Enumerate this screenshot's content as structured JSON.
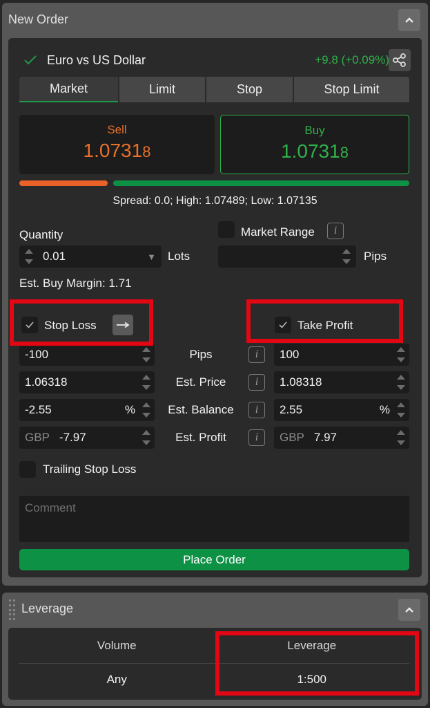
{
  "order_panel": {
    "title": "New Order",
    "collapse_icon": "chevron-up-icon",
    "instrument": {
      "status_icon": "check-icon",
      "name": "Euro vs US Dollar",
      "change": "+9.8 (+0.09%)",
      "share_icon": "share-icon"
    },
    "tabs": [
      {
        "label": "Market",
        "active": true
      },
      {
        "label": "Limit",
        "active": false
      },
      {
        "label": "Stop",
        "active": false
      },
      {
        "label": "Stop Limit",
        "active": false
      }
    ],
    "sell": {
      "label": "Sell",
      "price_main": "1.0731",
      "price_pip": "8",
      "color": "#e8702a"
    },
    "buy": {
      "label": "Buy",
      "price_main": "1.0731",
      "price_pip": "8",
      "color": "#2fb14a"
    },
    "sentiment": {
      "sell_fraction": 0.23,
      "buy_fraction": 0.77
    },
    "spread_text": "Spread: 0.0; High: 1.07489; Low: 1.07135",
    "quantity": {
      "label": "Quantity",
      "value": "0.01",
      "unit": "Lots"
    },
    "market_range": {
      "label": "Market Range",
      "checked": false,
      "value": "",
      "unit": "Pips"
    },
    "margin_text": "Est. Buy Margin: 1.71",
    "stop_loss": {
      "label": "Stop Loss",
      "checked": true,
      "arrow_icon": "arrow-right-icon",
      "pips": "-100",
      "price": "1.06318",
      "balance": "-2.55",
      "balance_unit": "%",
      "profit_currency": "GBP",
      "profit": "-7.97"
    },
    "take_profit": {
      "label": "Take Profit",
      "checked": true,
      "pips": "100",
      "price": "1.08318",
      "balance": "2.55",
      "balance_unit": "%",
      "profit_currency": "GBP",
      "profit": "7.97"
    },
    "row_labels": [
      "Pips",
      "Est. Price",
      "Est. Balance",
      "Est. Profit"
    ],
    "trailing_stop": {
      "label": "Trailing Stop Loss",
      "checked": false
    },
    "comment_placeholder": "Comment",
    "place_order_label": "Place Order",
    "accent_color": "#0d9145"
  },
  "leverage_panel": {
    "title": "Leverage",
    "columns": [
      "Volume",
      "Leverage"
    ],
    "rows": [
      [
        "Any",
        "1:500"
      ]
    ]
  },
  "annotations": {
    "highlight_color": "#e30613"
  }
}
